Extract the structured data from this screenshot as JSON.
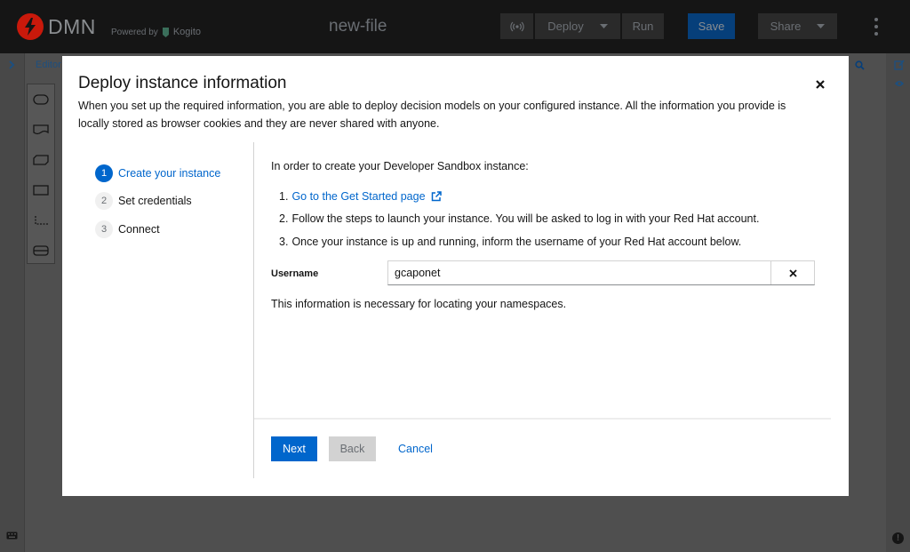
{
  "header": {
    "logo_text": "DMN",
    "powered_by": "Powered by",
    "powered_brand": "Kogito",
    "file_name": "new-file",
    "deploy_label": "Deploy",
    "run_label": "Run",
    "save_label": "Save",
    "share_label": "Share"
  },
  "editor": {
    "tab_label": "Editor"
  },
  "modal": {
    "title": "Deploy instance information",
    "description": "When you set up the required information, you are able to deploy decision models on your configured instance. All the information you provide is locally stored as browser cookies and they are never shared with anyone.",
    "steps": [
      {
        "number": "1",
        "label": "Create your instance",
        "active": true
      },
      {
        "number": "2",
        "label": "Set credentials",
        "active": false
      },
      {
        "number": "3",
        "label": "Connect",
        "active": false
      }
    ],
    "intro": "In order to create your Developer Sandbox instance:",
    "instructions": [
      {
        "number": "1.",
        "text": "Go to the Get Started page"
      },
      {
        "number": "2.",
        "text": "Follow the steps to launch your instance. You will be asked to log in with your Red Hat account."
      },
      {
        "number": "3.",
        "text": "Once your instance is up and running, inform the username of your Red Hat account below."
      }
    ],
    "username_label": "Username",
    "username_value": "gcaponet",
    "helper_text": "This information is necessary for locating your namespaces.",
    "next_label": "Next",
    "back_label": "Back",
    "cancel_label": "Cancel"
  },
  "colors": {
    "primary": "#0066cc",
    "logo_red": "#c9190b",
    "topbar": "#151515",
    "overlay_bg": "#4f4f4f"
  }
}
